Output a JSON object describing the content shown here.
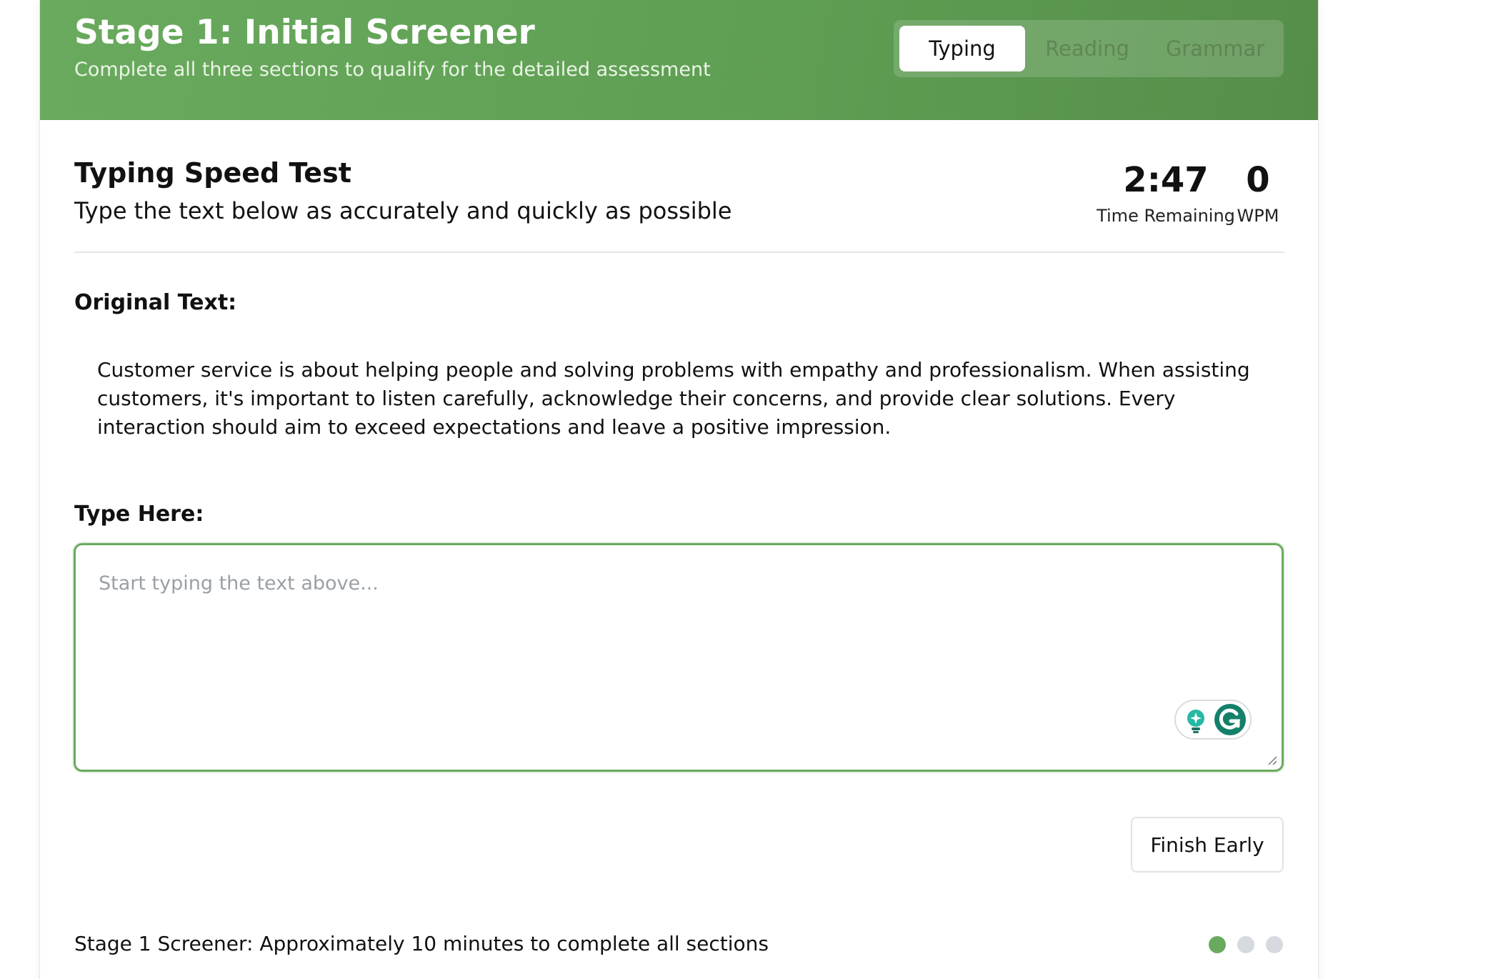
{
  "header": {
    "title": "Stage 1: Initial Screener",
    "subtitle": "Complete all three sections to qualify for the detailed assessment",
    "tabs": [
      {
        "label": "Typing",
        "active": true
      },
      {
        "label": "Reading",
        "active": false
      },
      {
        "label": "Grammar",
        "active": false
      }
    ]
  },
  "test": {
    "title": "Typing Speed Test",
    "subtitle": "Type the text below as accurately and quickly as possible",
    "time_remaining": "2:47",
    "time_label": "Time Remaining",
    "wpm": "0",
    "wpm_label": "WPM"
  },
  "original": {
    "label": "Original Text:",
    "text": "Customer service is about helping people and solving problems with empathy and professionalism. When assisting customers, it's important to listen carefully, acknowledge their concerns, and provide clear solutions. Every interaction should aim to exceed expectations and leave a positive impression."
  },
  "input": {
    "label": "Type Here:",
    "placeholder": "Start typing the text above...",
    "value": ""
  },
  "actions": {
    "finish_label": "Finish Early"
  },
  "footer": {
    "text": "Stage 1 Screener: Approximately 10 minutes to complete all sections",
    "progress": {
      "current": 1,
      "total": 3
    }
  },
  "colors": {
    "accent": "#6aaa5e",
    "header_start": "#6aaa5e",
    "header_end": "#558e4a",
    "dot_active": "#6aaa5e",
    "dot_inactive": "#d6d9de"
  },
  "icons": [
    "lightbulb-icon",
    "grammarly-logo-icon",
    "resize-handle-icon"
  ]
}
